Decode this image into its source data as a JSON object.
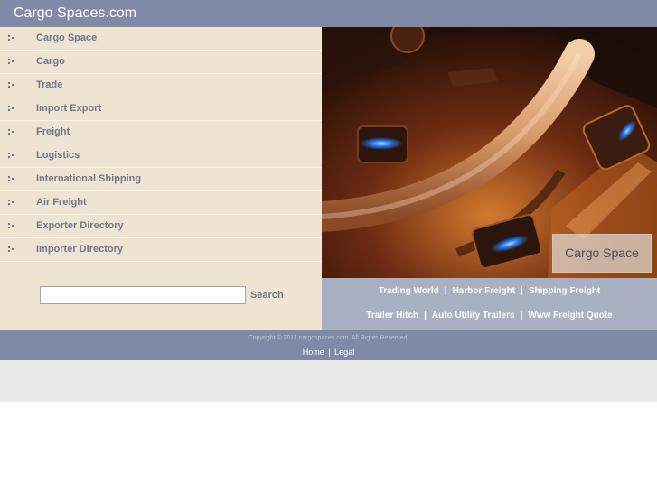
{
  "header": {
    "title": "Cargo Spaces.com"
  },
  "sidebar": {
    "items": [
      {
        "label": "Cargo Space"
      },
      {
        "label": "Cargo"
      },
      {
        "label": "Trade"
      },
      {
        "label": "Import Export"
      },
      {
        "label": "Freight"
      },
      {
        "label": "Logistics"
      },
      {
        "label": "International Shipping"
      },
      {
        "label": "Air Freight"
      },
      {
        "label": "Exporter Directory"
      },
      {
        "label": "Importer Directory"
      }
    ]
  },
  "search": {
    "value": "",
    "button_label": "Search"
  },
  "hero": {
    "caption": "Cargo Space"
  },
  "links": {
    "row1": [
      "Trading World",
      "Harbor Freight",
      "Shipping Freight"
    ],
    "row2": [
      "Trailer Hitch",
      "Auto Utility Trailers",
      "Www Freight Quote"
    ],
    "separator": "|"
  },
  "footer": {
    "copyright": "Copyright © 2011 cargospaces.com. All Rights Reserved.",
    "home": "Home",
    "divider": "|",
    "legal": "Legal"
  }
}
